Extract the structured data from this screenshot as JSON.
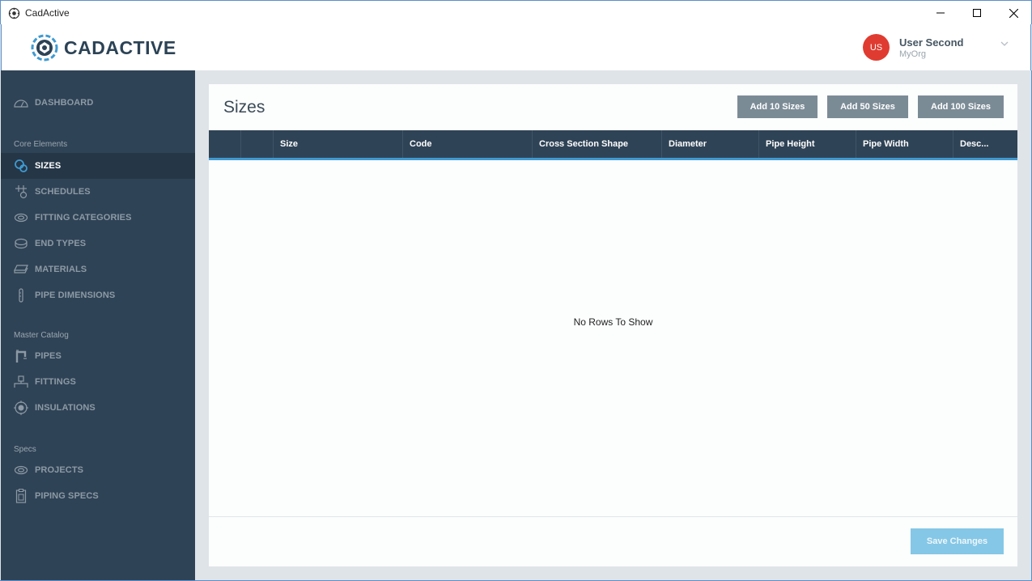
{
  "window": {
    "title": "CadActive"
  },
  "header": {
    "logo_text": "CADACTIVE",
    "user": {
      "initials": "US",
      "name": "User Second",
      "org": "MyOrg"
    }
  },
  "sidebar": {
    "dashboard": "DASHBOARD",
    "sections": {
      "core": "Core Elements",
      "catalog": "Master Catalog",
      "specs": "Specs"
    },
    "items": {
      "sizes": "SIZES",
      "schedules": "SCHEDULES",
      "fitting_categories": "FITTING CATEGORIES",
      "end_types": "END TYPES",
      "materials": "MATERIALS",
      "pipe_dimensions": "PIPE DIMENSIONS",
      "pipes": "PIPES",
      "fittings": "FITTINGS",
      "insulations": "INSULATIONS",
      "projects": "PROJECTS",
      "piping_specs": "PIPING SPECS"
    },
    "active": "sizes"
  },
  "main": {
    "title": "Sizes",
    "buttons": {
      "add10": "Add 10 Sizes",
      "add50": "Add 50 Sizes",
      "add100": "Add 100 Sizes",
      "save": "Save Changes"
    },
    "columns": [
      "",
      "",
      "Size",
      "Code",
      "Cross Section Shape",
      "Diameter",
      "Pipe Height",
      "Pipe Width",
      "Desc..."
    ],
    "empty_message": "No Rows To Show"
  },
  "colors": {
    "sidebar_bg": "#2f4356",
    "accent": "#3f9ad0",
    "avatar": "#e03b30",
    "save_button": "#85c7e6"
  }
}
